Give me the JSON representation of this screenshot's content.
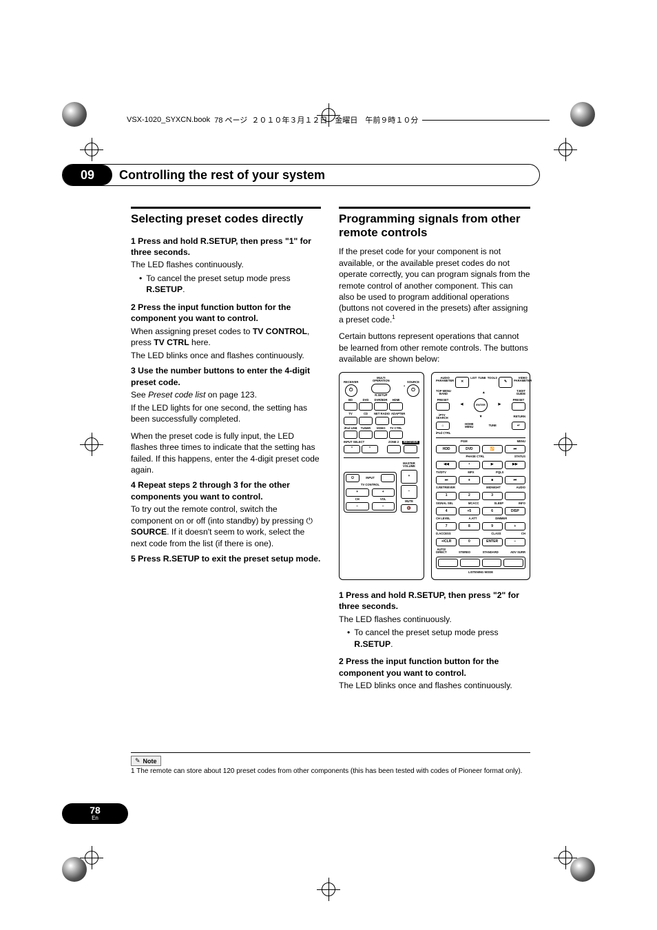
{
  "header": {
    "file": "VSX-1020_SYXCN.book",
    "page_jp": "78 ページ",
    "date_jp": "２０１０年３月１２日　金曜日　午前９時１０分"
  },
  "chapter": {
    "number": "09",
    "title": "Controlling the rest of your system"
  },
  "left": {
    "h1": "Selecting preset codes directly",
    "s1a": "1    Press and hold R.SETUP, then press \"1\" for three seconds.",
    "s1b": "The LED flashes continuously.",
    "s1c_pre": "To cancel the preset setup mode press ",
    "s1c_b": "R.SETUP",
    "s1c_post": ".",
    "s2a": "2    Press the input function button for the component you want to control.",
    "s2b_pre": "When assigning preset codes to ",
    "s2b_b1": "TV CONTROL",
    "s2b_mid": ", press ",
    "s2b_b2": "TV CTRL",
    "s2b_post": " here.",
    "s2c": "The LED blinks once and flashes continuously.",
    "s3a": "3    Use the number buttons to enter the 4-digit preset code.",
    "s3b_pre": "See ",
    "s3b_i": "Preset code list",
    "s3b_post": " on page 123.",
    "s3c": "If the LED lights for one second, the setting has been successfully completed.",
    "s3d": "When the preset code is fully input, the LED flashes three times to indicate that the setting has failed. If this happens, enter the 4-digit preset code again.",
    "s4a": "4    Repeat steps 2 through 3 for the other components you want to control.",
    "s4b_pre": "To try out the remote control, switch the component on or off (into standby) by pressing ",
    "s4b_sym": "⏻",
    "s4b_b": " SOURCE",
    "s4b_post": ". If it doesn't seem to work, select the next code from the list (if there is one).",
    "s5a": "5    Press R.SETUP to exit the preset setup mode."
  },
  "right": {
    "h1": "Programming signals from other remote controls",
    "p1": "If the preset code for your component is not available, or the available preset codes do not operate correctly, you can program signals from the remote control of another component. This can also be used to program additional operations (buttons not covered in the presets) after assigning a preset code.",
    "sup1": "1",
    "p2": "Certain buttons represent operations that cannot be learned from other remote controls. The buttons available are shown below:",
    "s1a": "1    Press and hold R.SETUP, then press \"2\" for three seconds.",
    "s1b": "The LED flashes continuously.",
    "s1c_pre": "To cancel the preset setup mode press ",
    "s1c_b": "R.SETUP",
    "s1c_post": ".",
    "s2a": "2    Press the input function button for the component you want to control.",
    "s2b": "The LED blinks once and flashes continuously."
  },
  "remoteA": {
    "topLabels": [
      "RECEIVER",
      "MULTI\nOPERATION",
      "SOURCE"
    ],
    "rsetup": "R.SETUP",
    "inputRows": [
      [
        "BD",
        "DVD",
        "DVR/BDR",
        "HDMI"
      ],
      [
        "TV",
        "CD",
        "NET RADIO",
        "ADAPTER"
      ],
      [
        "iPod USB",
        "TUNER",
        "VIDEO",
        "TV CTRL"
      ]
    ],
    "inputSelect": "INPUT SELECT",
    "zone2": "ZONE 2",
    "receiver": "RECEIVER",
    "input": "INPUT",
    "masterVol": "MASTER\nVOLUME",
    "tvControl": "TV CONTROL",
    "chPlus": "+",
    "chMinus": "−",
    "volPlus": "+",
    "volMinus": "−",
    "ch": "CH",
    "vol": "VOL",
    "mute": "MUTE",
    "muteSym": "🔇",
    "tvPwr": "⏻"
  },
  "remoteB": {
    "audioParam": "AUDIO\nPARAMETER",
    "videoParam": "VIDEO\nPARAMETER",
    "x": "✕",
    "list": "LIST",
    "tune": "TUNE",
    "tools": "TOOLS",
    "pencil": "✎",
    "topMenuBand": "TOP MENU\nBAND",
    "teditGuide": "T.EDIT\nGUIDE",
    "preset": "PRESET",
    "enter": "ENTER",
    "iptvSearch": "iPTV\nSEARCH",
    "return": "RETURN",
    "home": "⌂",
    "homeMenu": "HOME\nMENU",
    "tune2": "TUNE",
    "returnSym": "↵",
    "ipodCtrl": "iPod CTRL",
    "pgm": "PGM",
    "menu": "MENU",
    "hdd": "HDD",
    "dvd": "DVD",
    "repeat": "🔁",
    "prev": "⏮",
    "phaseCtrl": "PHASE CTRL",
    "status": "STATUS",
    "rew": "◀◀",
    "play": "▶",
    "next": "▶▶",
    "tvdtv": "TV/DTV",
    "mpx": "MPX",
    "pqls": "PQLS",
    "skipf": "⏭",
    "pause": "⏸",
    "stop": "■",
    "skipb": "⏮",
    "sretriever": "S.RETRIEVER",
    "midnight": "MIDNIGHT",
    "audio": "AUDIO",
    "n1": "1",
    "n2": "2",
    "n3": "3",
    "signalSel": "SIGNAL SEL",
    "mcacc": "MCACC",
    "sleep": "SLEEP",
    "info": "INFO",
    "n4": "4",
    "n5": "+5",
    "n6": "6",
    "disp": "DISP",
    "chLevel": "CH LEVEL",
    "aatt": "A.ATT",
    "dimmer": "DIMMER",
    "n7": "7",
    "n8": "8",
    "n9": "9",
    "plus": "+",
    "daccess": "D.ACCESS",
    "class": "CLASS",
    "ch": "CH",
    "plusclr": "+/CLR",
    "n0": "0",
    "enter2": "ENTER",
    "minus": "−",
    "autodirect": "AUTO/\nDIRECT",
    "stereo": "STEREO",
    "standard": "STANDARD",
    "advSurr": "ADV SURR",
    "listeningMode": "LISTENING MODE"
  },
  "footnote": {
    "label": "Note",
    "text": "1  The remote can store about 120 preset codes from other components (this has been tested with codes of Pioneer format only)."
  },
  "page": {
    "number": "78",
    "lang": "En"
  }
}
